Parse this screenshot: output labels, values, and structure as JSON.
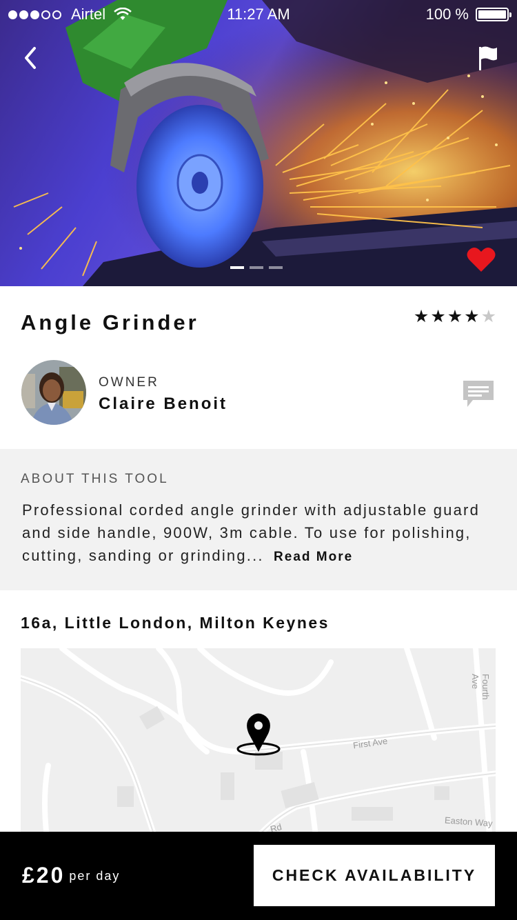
{
  "status_bar": {
    "carrier": "Airtel",
    "time": "11:27 AM",
    "battery": "100 %",
    "signal_bars_filled": 3,
    "signal_bars_total": 5
  },
  "hero": {
    "image_pages": 3,
    "active_page": 1,
    "favorited": true,
    "colors": {
      "heart": "#e8171e"
    }
  },
  "tool": {
    "title": "Angle Grinder",
    "rating": 4,
    "rating_max": 5
  },
  "owner": {
    "label": "OWNER",
    "name": "Claire Benoit"
  },
  "about": {
    "heading": "ABOUT THIS TOOL",
    "text": "Professional corded angle grinder with adjustable guard and side handle, 900W, 3m cable. To use for polishing, cutting, sanding or grinding...",
    "read_more": "Read More"
  },
  "location": {
    "address": "16a, Little London, Milton Keynes",
    "map_labels": {
      "first_ave": "First Ave",
      "fourth_ave": "Fourth Ave",
      "easton_way": "Easton Way",
      "rd": "Rd"
    }
  },
  "footer": {
    "price": "£20",
    "price_unit": "per day",
    "cta": "CHECK AVAILABILITY"
  }
}
